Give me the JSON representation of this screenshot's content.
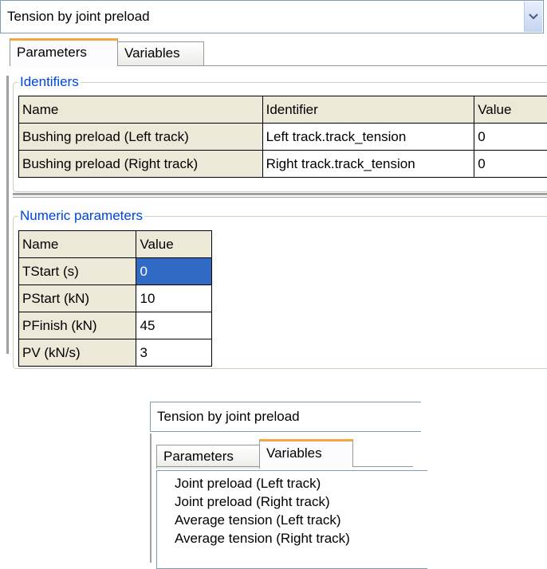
{
  "top_panel": {
    "combo_value": "Tension by joint preload",
    "tabs": [
      "Parameters",
      "Variables"
    ],
    "identifiers_group": {
      "title": "Identifiers",
      "headers": [
        "Name",
        "Identifier",
        "Value"
      ],
      "rows": [
        [
          "Bushing preload (Left track)",
          "Left track.track_tension",
          "0"
        ],
        [
          "Bushing preload (Right track)",
          "Right track.track_tension",
          "0"
        ]
      ]
    },
    "numeric_group": {
      "title": "Numeric parameters",
      "headers": [
        "Name",
        "Value"
      ],
      "rows": [
        [
          "TStart (s)",
          "0"
        ],
        [
          "PStart (kN)",
          "10"
        ],
        [
          "PFinish (kN)",
          "45"
        ],
        [
          "PV (kN/s)",
          "3"
        ]
      ],
      "selected_row": 0
    }
  },
  "bottom_panel": {
    "combo_value": "Tension by joint preload",
    "tabs": [
      "Parameters",
      "Variables"
    ],
    "variables": [
      "Joint preload (Left track)",
      "Joint preload (Right track)",
      "Average tension (Left track)",
      "Average tension (Right track)"
    ]
  },
  "colors": {
    "selection": "#316ac5",
    "group_title": "#0046d5",
    "active_tab_accent": "#f5a640"
  }
}
